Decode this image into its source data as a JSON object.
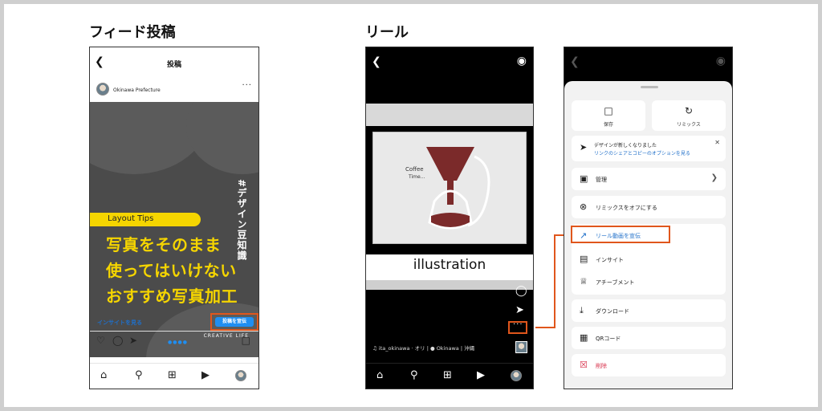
{
  "sections": {
    "feed_title": "フィード投稿",
    "reel_title": "リール"
  },
  "feed": {
    "header_title": "投稿",
    "username": "Okinawa Prefecture",
    "post": {
      "vertical_tag": "#デザイン豆知識",
      "tip_label": "Layout Tips",
      "headline_lines": [
        "写真をそのまま",
        "使ってはいけない",
        "おすすめ写真加工"
      ],
      "brand": "CREATIVE LIFE"
    },
    "insight_link": "インサイトを見る",
    "promote_button": "投稿を宣伝"
  },
  "reel": {
    "illustration_caption": "illustration",
    "meta_text": "♫ ita_okinawa · オリ | ● Okinawa | 沖縄"
  },
  "sheet": {
    "save_label": "保存",
    "remix_label": "リミックス",
    "notice_title": "デザインが新しくなりました",
    "notice_link": "リンクのシェアとコピーのオプションを見る",
    "items": {
      "manage": "管理",
      "remix_off": "リミックスをオフにする",
      "promote": "リール動画を宣伝",
      "insights": "インサイト",
      "achievements": "アチーブメント",
      "download": "ダウンロード",
      "qr": "QRコード",
      "delete": "削除"
    }
  },
  "colors": {
    "accent_orange": "#e0561c",
    "promo_blue": "#1f8ef1",
    "headline_yellow": "#f5d500",
    "delete_red": "#d8324c"
  }
}
